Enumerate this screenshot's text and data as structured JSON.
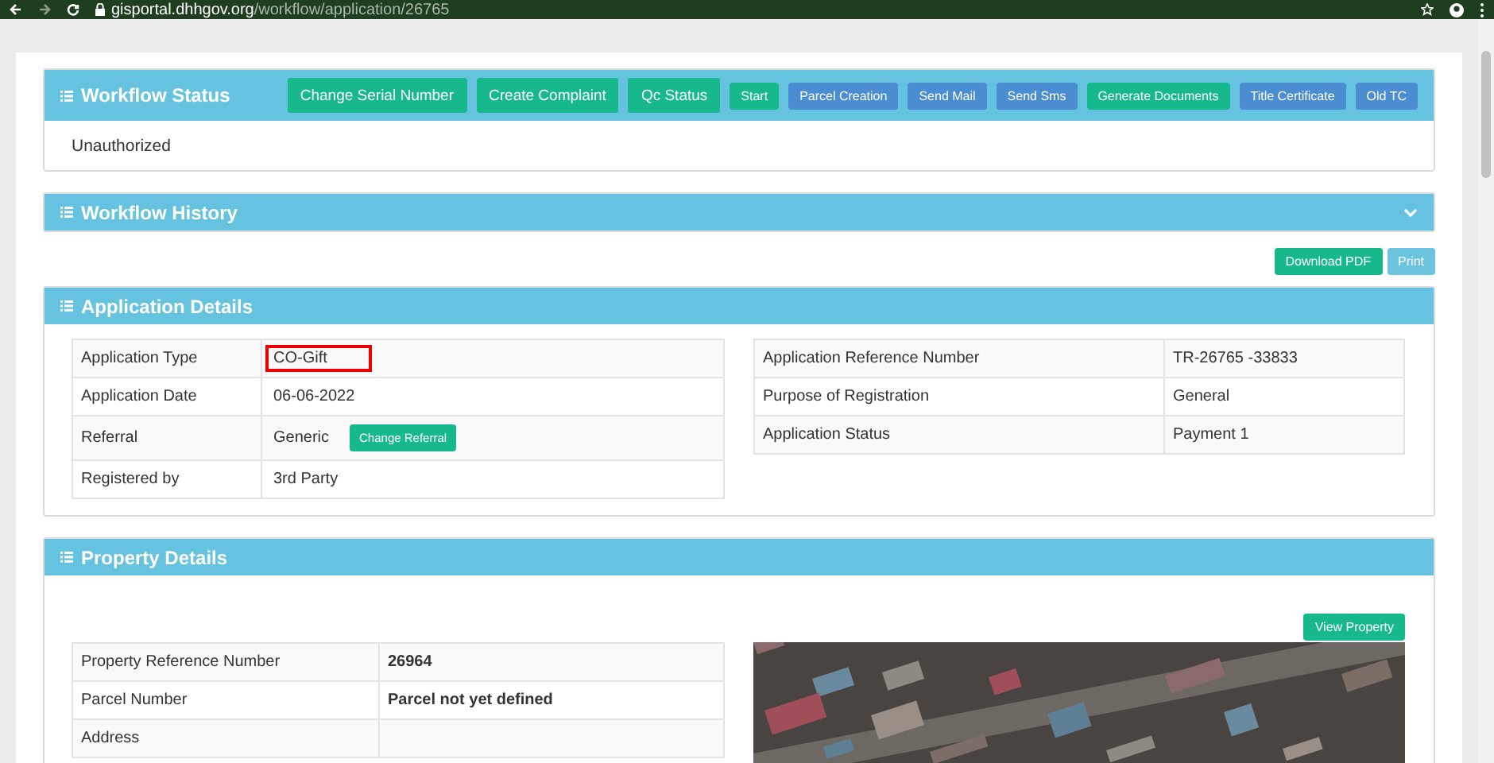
{
  "browser": {
    "url_domain": "gisportal.dhhgov.org",
    "url_path": "/workflow/application/26765"
  },
  "workflow_status": {
    "title": "Workflow Status",
    "status": "Unauthorized",
    "buttons": [
      {
        "label": "Change Serial Number",
        "kind": "large",
        "color": "#17b98c"
      },
      {
        "label": "Create Complaint",
        "kind": "large",
        "color": "#17b98c"
      },
      {
        "label": "Qc Status",
        "kind": "large",
        "color": "#17b98c"
      },
      {
        "label": "Start",
        "kind": "small",
        "color": "#17b98c"
      },
      {
        "label": "Parcel Creation",
        "kind": "small",
        "color": "#4a8dd0"
      },
      {
        "label": "Send Mail",
        "kind": "small",
        "color": "#4a8dd0"
      },
      {
        "label": "Send Sms",
        "kind": "small",
        "color": "#4a8dd0"
      },
      {
        "label": "Generate Documents",
        "kind": "small",
        "color": "#17b98c"
      },
      {
        "label": "Title Certificate",
        "kind": "small",
        "color": "#4a8dd0"
      },
      {
        "label": "Old TC",
        "kind": "small",
        "color": "#4a8dd0"
      }
    ]
  },
  "workflow_history": {
    "title": "Workflow History",
    "expanded": false
  },
  "actions": [
    {
      "label": "Download PDF",
      "disabled": false
    },
    {
      "label": "Print",
      "disabled": true
    }
  ],
  "application_details": {
    "title": "Application Details",
    "left": [
      {
        "label": "Application Type",
        "value": "CO-Gift",
        "highlighted": true
      },
      {
        "label": "Application Date",
        "value": "06-06-2022",
        "highlighted": false
      },
      {
        "label": "Referral",
        "value": "Generic",
        "highlighted": false,
        "button": "Change Referral"
      },
      {
        "label": "Registered by",
        "value": "3rd Party",
        "highlighted": false
      }
    ],
    "right": [
      {
        "label": "Application Reference Number",
        "value": "TR-26765 -33833"
      },
      {
        "label": "Purpose of Registration",
        "value": "General"
      },
      {
        "label": "Application Status",
        "value": "Payment 1"
      }
    ]
  },
  "property_details": {
    "title": "Property Details",
    "view_button": "View Property",
    "rows": [
      {
        "label": "Property Reference Number",
        "value": "26964"
      },
      {
        "label": "Parcel Number",
        "value": "Parcel not yet defined"
      },
      {
        "label": "Address"
      }
    ]
  }
}
